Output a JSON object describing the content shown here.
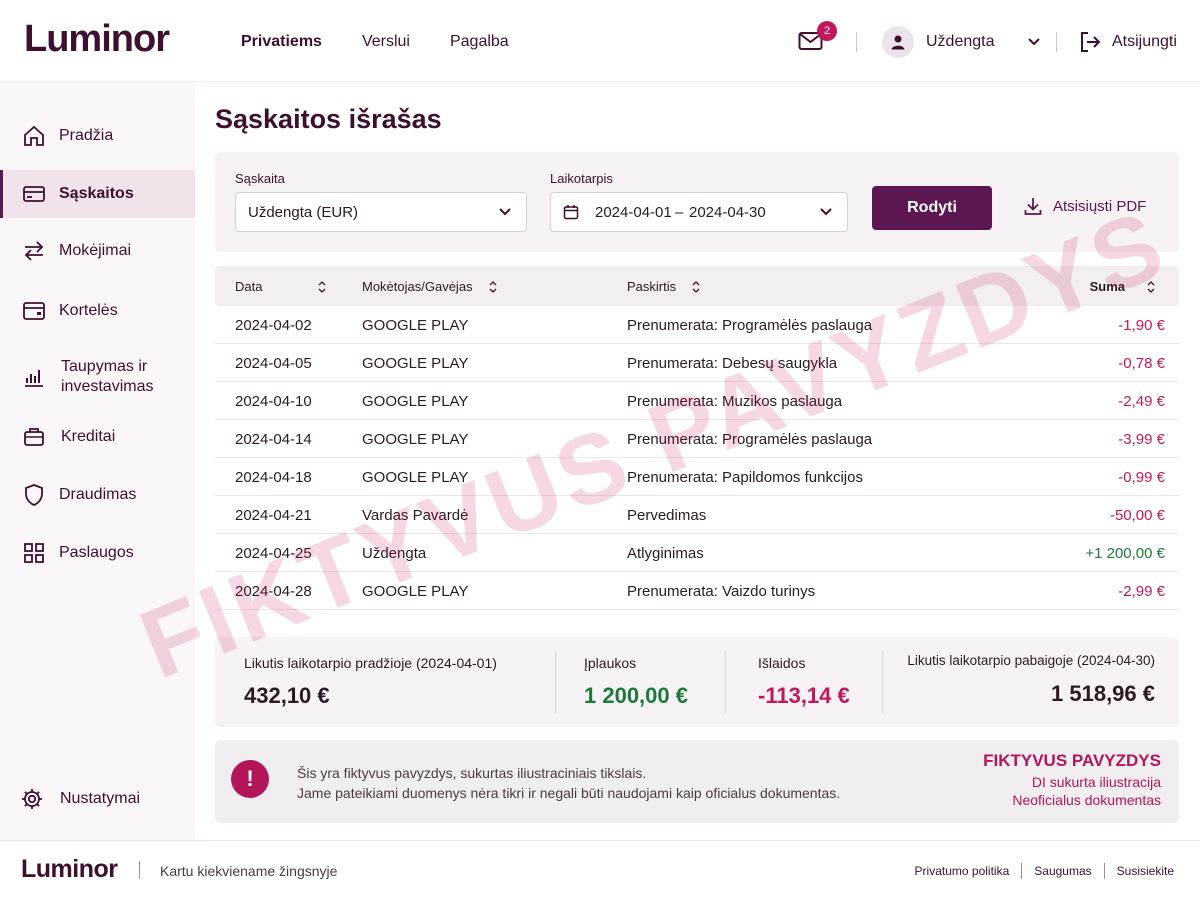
{
  "header": {
    "logo": "Luminor",
    "nav": [
      "Privatiems",
      "Verslui",
      "Pagalba"
    ],
    "mail_badge": "2",
    "user_name": "Uždengta",
    "logout": "Atsijungti"
  },
  "sidebar": {
    "items": [
      "Pradžia",
      "Sąskaitos",
      "Mokėjimai",
      "Kortelės",
      "Taupymas ir\ninvestavimas",
      "Kreditai",
      "Draudimas",
      "Paslaugos"
    ],
    "settings": "Nustatymai"
  },
  "page": {
    "title": "Sąskaitos išrašas"
  },
  "filter": {
    "account_label": "Sąskaita",
    "account_value": "Uždengta (EUR)",
    "period_label": "Laikotarpis",
    "date_from": "2024-04-01",
    "date_sep": "–",
    "date_to": "2024-04-30",
    "show_button": "Rodyti",
    "download": "Atsisiųsti PDF"
  },
  "table": {
    "headers": [
      "Data",
      "Mokėtojas/Gavėjas",
      "Paskirtis",
      "Suma"
    ],
    "rows": [
      {
        "date": "2024-04-02",
        "party": "GOOGLE PLAY",
        "purpose": "Prenumerata: Programėlės paslauga",
        "amount": "-1,90 €",
        "sign": "neg"
      },
      {
        "date": "2024-04-05",
        "party": "GOOGLE PLAY",
        "purpose": "Prenumerata: Debesų saugykla",
        "amount": "-0,78 €",
        "sign": "neg"
      },
      {
        "date": "2024-04-10",
        "party": "GOOGLE PLAY",
        "purpose": "Prenumerata: Muzikos paslauga",
        "amount": "-2,49 €",
        "sign": "neg"
      },
      {
        "date": "2024-04-14",
        "party": "GOOGLE PLAY",
        "purpose": "Prenumerata: Programėlės paslauga",
        "amount": "-3,99 €",
        "sign": "neg"
      },
      {
        "date": "2024-04-18",
        "party": "GOOGLE PLAY",
        "purpose": "Prenumerata: Papildomos funkcijos",
        "amount": "-0,99 €",
        "sign": "neg"
      },
      {
        "date": "2024-04-21",
        "party": "Vardas Pavardė",
        "purpose": "Pervedimas",
        "amount": "-50,00 €",
        "sign": "neg"
      },
      {
        "date": "2024-04-25",
        "party": "Uždengta",
        "purpose": "Atlyginimas",
        "amount": "+1 200,00 €",
        "sign": "pos"
      },
      {
        "date": "2024-04-28",
        "party": "GOOGLE PLAY",
        "purpose": "Prenumerata: Vaizdo turinys",
        "amount": "-2,99 €",
        "sign": "neg"
      }
    ]
  },
  "summary": {
    "start_label": "Likutis laikotarpio pradžioje (2024-04-01)",
    "start_value": "432,10 €",
    "in_label": "Įplaukos",
    "in_value": "1 200,00 €",
    "out_label": "Išlaidos",
    "out_value": "-113,14 €",
    "end_label": "Likutis laikotarpio pabaigoje (2024-04-30)",
    "end_value": "1 518,96 €"
  },
  "notice": {
    "line1": "Šis yra fiktyvus pavyzdys, sukurtas iliustraciniais tikslais.",
    "line2": "Jame pateikiami duomenys nėra tikri ir negali būti naudojami kaip oficialus dokumentas.",
    "stamp_title": "FIKTYVUS PAVYZDYS",
    "stamp_line1": "DI sukurta iliustracija",
    "stamp_line2": "Neoficialus dokumentas"
  },
  "footer": {
    "logo": "Luminor",
    "tagline": "Kartu kiekviename žingsnyje",
    "links": [
      "Privatumo politika",
      "Saugumas",
      "Susisiekite"
    ]
  },
  "watermark": "FIKTYVUS PAVYZDYS",
  "colors": {
    "brand": "#3d1030",
    "accent": "#5c1650",
    "negative": "#c2185b",
    "positive": "#1b7a3a"
  }
}
